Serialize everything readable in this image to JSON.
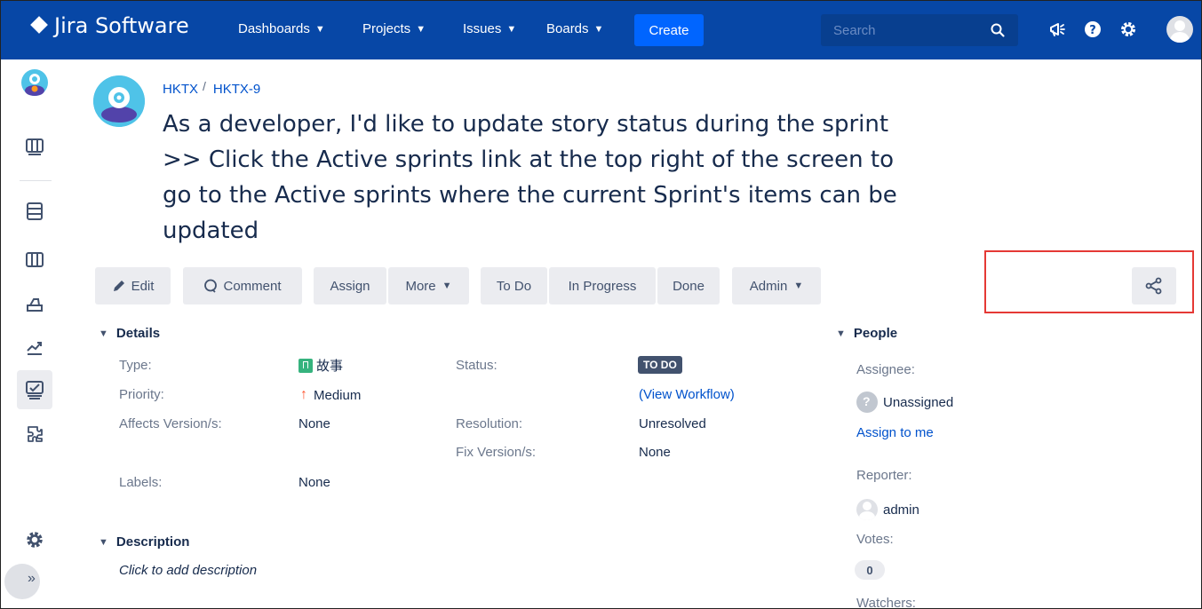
{
  "nav": {
    "logo_text": "Jira Software",
    "items": [
      {
        "label": "Dashboards"
      },
      {
        "label": "Projects"
      },
      {
        "label": "Issues"
      },
      {
        "label": "Boards"
      }
    ],
    "create_label": "Create",
    "search_placeholder": "Search",
    "icons": [
      "search-icon",
      "megaphone-icon",
      "help-icon",
      "settings-icon",
      "user-avatar"
    ]
  },
  "sidebar": {
    "icons": [
      "project-avatar",
      "board-icon",
      "backlog-icon",
      "active-sprints-icon",
      "releases-icon",
      "reports-icon",
      "issues-icon",
      "components-icon",
      "settings-icon",
      "expand-icon"
    ]
  },
  "issue": {
    "breadcrumb": {
      "project": "HKTX",
      "key": "HKTX-9",
      "separator": "/"
    },
    "summary_lines": [
      "As a developer, I'd like to update story status during the sprint",
      ">> Click the Active sprints link at the top right of the screen to",
      "go to the Active sprints where the current Sprint's items can be",
      "updated"
    ]
  },
  "toolbar": {
    "edit": "Edit",
    "comment": "Comment",
    "assign": "Assign",
    "more": "More",
    "todo": "To Do",
    "in_progress": "In Progress",
    "done": "Done",
    "admin": "Admin"
  },
  "details": {
    "title": "Details",
    "type_label": "Type:",
    "type_value": "故事",
    "priority_label": "Priority:",
    "priority_value": "Medium",
    "affects_label": "Affects Version/s:",
    "affects_value": "None",
    "labels_label": "Labels:",
    "labels_value": "None",
    "status_label": "Status:",
    "status_value": "TO DO",
    "view_workflow": "(View Workflow)",
    "resolution_label": "Resolution:",
    "resolution_value": "Unresolved",
    "fix_label": "Fix Version/s:",
    "fix_value": "None"
  },
  "description": {
    "title": "Description",
    "placeholder": "Click to add description"
  },
  "people": {
    "title": "People",
    "assignee_label": "Assignee:",
    "assignee_value": "Unassigned",
    "assign_to_me": "Assign to me",
    "reporter_label": "Reporter:",
    "reporter_value": "admin",
    "votes_label": "Votes:",
    "votes_value": "0",
    "watchers_label": "Watchers:"
  },
  "colors": {
    "nav_bg": "#0747a6",
    "create_bg": "#0065ff",
    "link": "#0052cc",
    "story": "#36b37e",
    "priority_medium": "#ff5630",
    "highlight": "#e53935"
  }
}
